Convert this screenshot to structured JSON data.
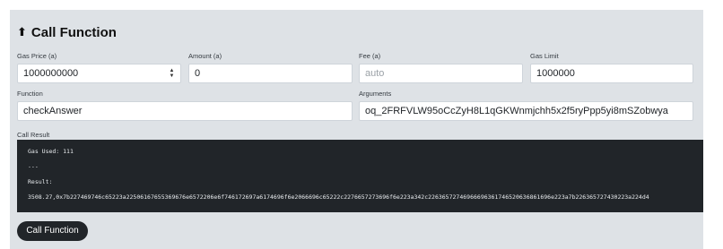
{
  "title": "Call Function",
  "fields": {
    "gas_price": {
      "label": "Gas Price (a)",
      "value": "1000000000"
    },
    "amount": {
      "label": "Amount (a)",
      "value": "0"
    },
    "fee": {
      "label": "Fee (a)",
      "placeholder": "auto"
    },
    "gas_limit": {
      "label": "Gas Limit",
      "value": "1000000"
    },
    "function": {
      "label": "Function",
      "value": "checkAnswer"
    },
    "arguments": {
      "label": "Arguments",
      "value": "oq_2FRFVLW95oCcZyH8L1qGKWnmjchh5x2f5ryPpp5yi8mSZobwya"
    }
  },
  "result": {
    "label": "Call Result",
    "gas_used": "Gas Used: 111",
    "separator": "---",
    "result_label": "Result:",
    "result_value": "3508.27,0x7b227469746c65223a22506167655369676e6572206e6f746172697a6174696f6e2066696c65222c2276657273696f6e223a342c22636572746966696361746520636861696e223a7b226365727430223a224d4"
  },
  "button_label": "Call Function"
}
